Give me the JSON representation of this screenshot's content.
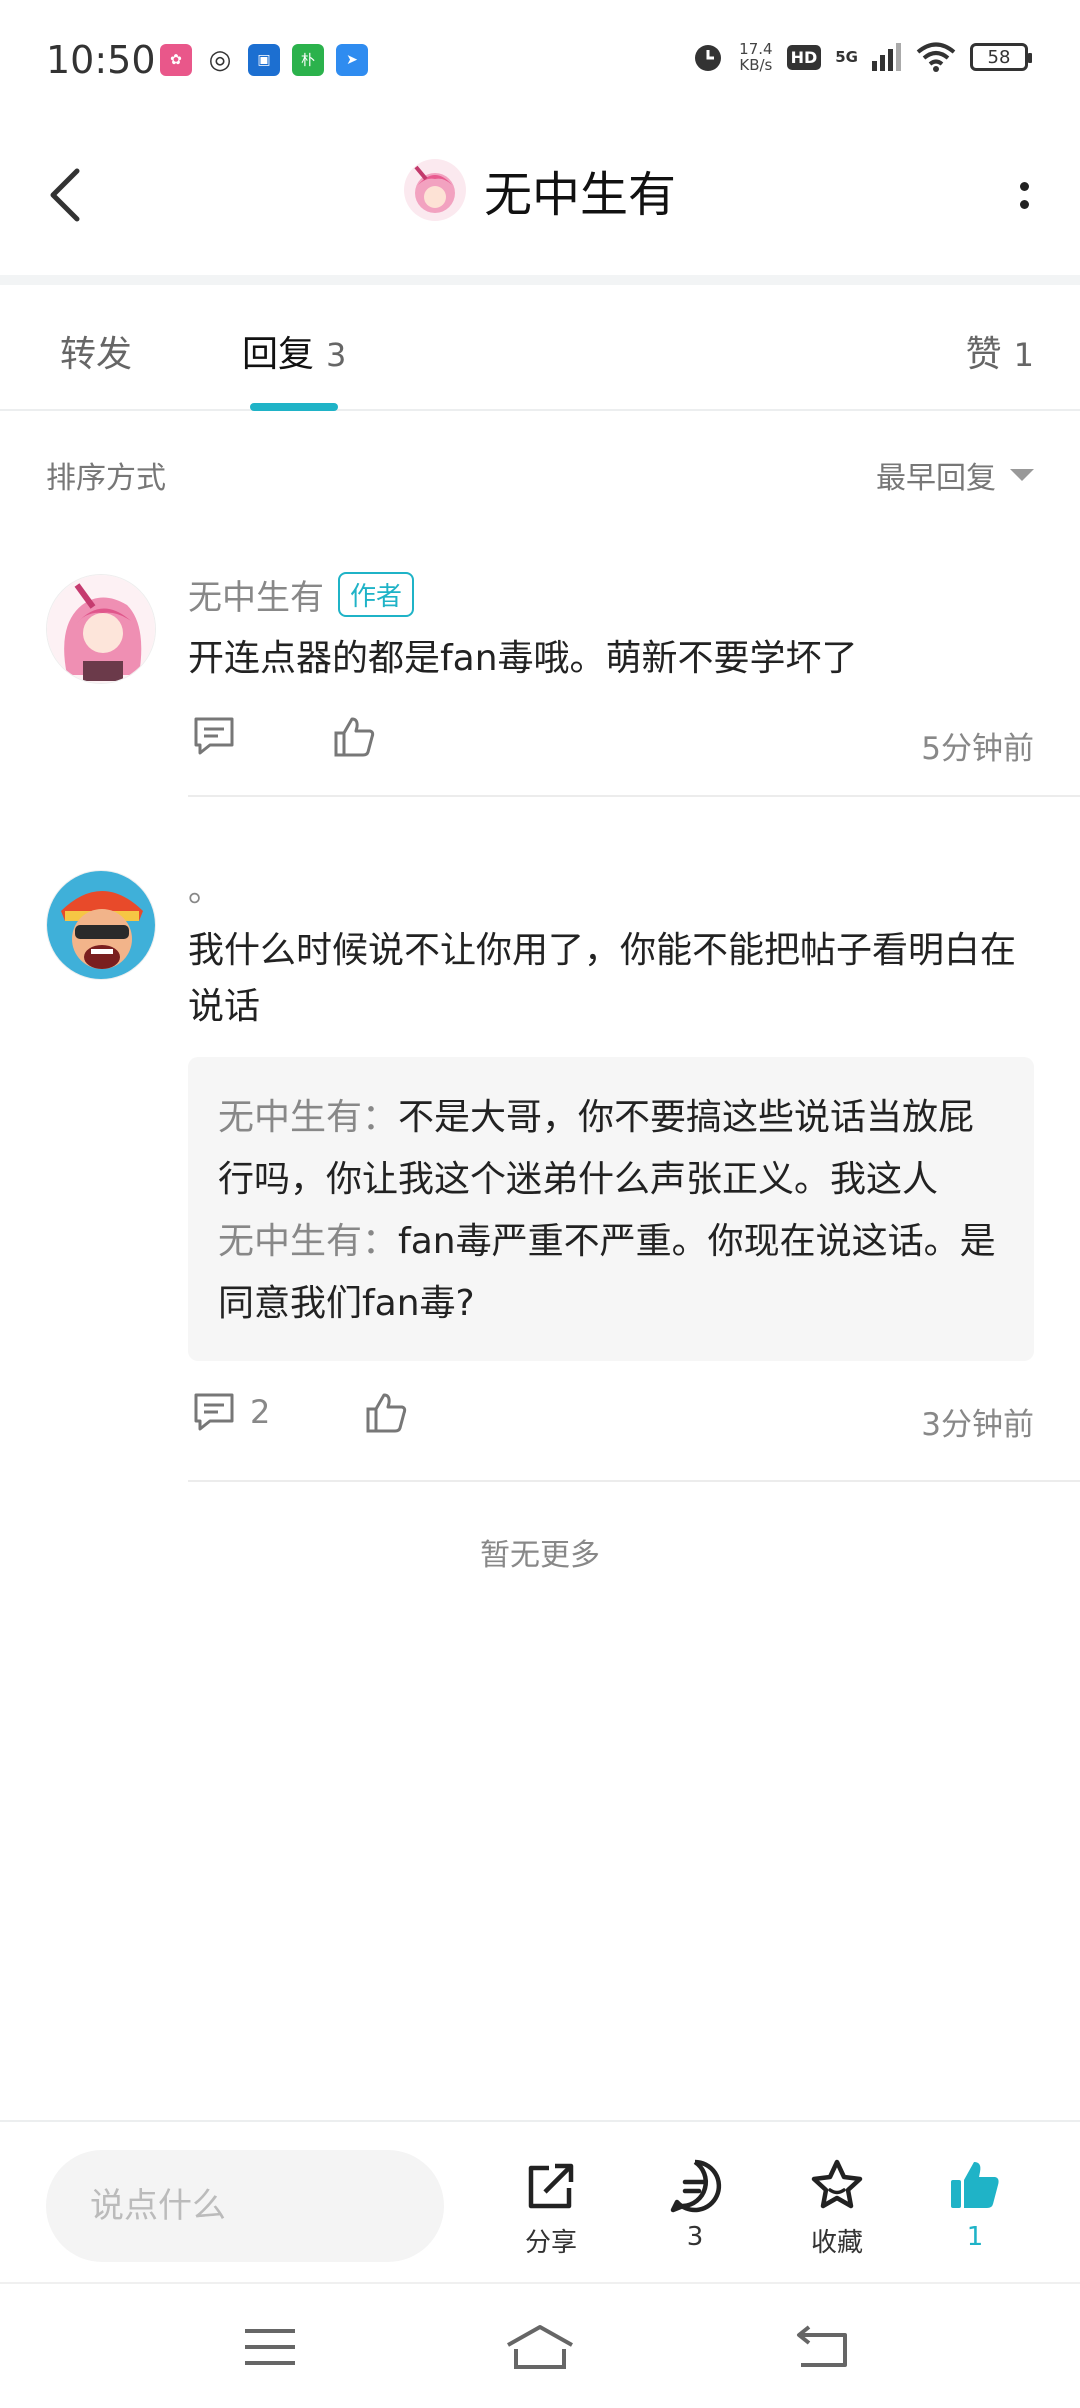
{
  "status_bar": {
    "time": "10:50",
    "speed_value": "17.4",
    "speed_unit": "KB/s",
    "hd": "HD",
    "signal": "5G",
    "battery": "58"
  },
  "header": {
    "title": "无中生有"
  },
  "tabs": [
    {
      "label": "转发",
      "count": ""
    },
    {
      "label": "回复",
      "count": "3"
    },
    {
      "label": "赞",
      "count": "1"
    }
  ],
  "sort": {
    "label": "排序方式",
    "value": "最早回复"
  },
  "comments": [
    {
      "name": "无中生有",
      "badge": "作者",
      "text": "开连点器的都是fan毒哦。萌新不要学坏了",
      "reply_count": "",
      "time": "5分钟前"
    },
    {
      "name": "。",
      "text": "我什么时候说不让你用了，你能不能把帖子看明白在说话",
      "reply_count": "2",
      "time": "3分钟前",
      "replies": [
        {
          "name": "无中生有",
          "sep": "：",
          "text": "不是大哥，你不要搞这些说话当放屁行吗，你让我这个迷弟什么声张正义。我这人"
        },
        {
          "name": "无中生有",
          "sep": "：",
          "text": "fan毒严重不严重。你现在说这话。是同意我们fan毒?"
        }
      ]
    }
  ],
  "no_more": "暂无更多",
  "bottom_bar": {
    "input_placeholder": "说点什么",
    "share_label": "分享",
    "comment_count": "3",
    "favorite_label": "收藏",
    "like_count": "1"
  },
  "colors": {
    "accent": "#1fb3c7"
  }
}
